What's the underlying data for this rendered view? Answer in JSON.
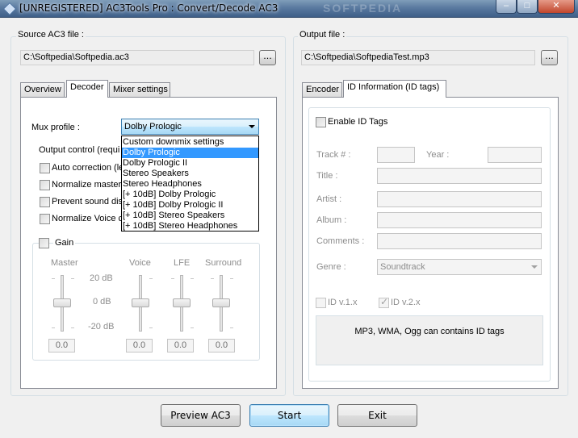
{
  "window": {
    "title": "[UNREGISTERED] AC3Tools Pro : Convert/Decode AC3",
    "watermark": "SOFTPEDIA"
  },
  "source": {
    "group_label": "Source AC3 file :",
    "path": "C:\\Softpedia\\Softpedia.ac3",
    "browse_label": "..."
  },
  "output": {
    "group_label": "Output file :",
    "path": "C:\\Softpedia\\SoftpediaTest.mp3",
    "browse_label": "..."
  },
  "left_tabs": [
    {
      "label": "Overview"
    },
    {
      "label": "Decoder"
    },
    {
      "label": "Mixer settings"
    }
  ],
  "decoder": {
    "mux_profile_label": "Mux profile :",
    "mux_profile_value": "Dolby Prologic",
    "mux_profile_options": [
      "Custom downmix settings",
      "Dolby Prologic",
      "Dolby Prologic II",
      "Stereo Speakers",
      "Stereo Headphones",
      "[+ 10dB] Dolby Prologic",
      "[+ 10dB] Dolby Prologic II",
      "[+ 10dB] Stereo Speakers",
      "[+ 10dB] Stereo Headphones"
    ],
    "output_control_label": "Output control (requi",
    "checkboxes": [
      {
        "label": "Auto correction (le"
      },
      {
        "label": "Normalize master"
      },
      {
        "label": "Prevent sound dis"
      },
      {
        "label": "Normalize Voice ch"
      }
    ],
    "gain_label": "Gain",
    "sliders": {
      "master_label": "Master",
      "voice_label": "Voice",
      "lfe_label": "LFE",
      "surround_label": "Surround",
      "scale_top": "20 dB",
      "scale_mid": "0 dB",
      "scale_bottom": "-20 dB",
      "master_value": "0.0",
      "voice_value": "0.0",
      "lfe_value": "0.0",
      "surround_value": "0.0"
    }
  },
  "right_tabs": [
    {
      "label": "Encoder"
    },
    {
      "label": "ID Information (ID tags)"
    }
  ],
  "id_info": {
    "enable_label": "Enable ID Tags",
    "track_label": "Track # :",
    "year_label": "Year :",
    "title_label": "Title :",
    "artist_label": "Artist :",
    "album_label": "Album :",
    "comments_label": "Comments :",
    "genre_label": "Genre :",
    "genre_value": "Soundtrack",
    "idv1_label": "ID v.1.x",
    "idv2_label": "ID v.2.x",
    "info_text": "MP3, WMA, Ogg can contains ID tags"
  },
  "buttons": {
    "preview": "Preview AC3",
    "start": "Start",
    "exit": "Exit"
  },
  "title_buttons": {
    "min": "–",
    "max": "□",
    "close": "✕"
  }
}
